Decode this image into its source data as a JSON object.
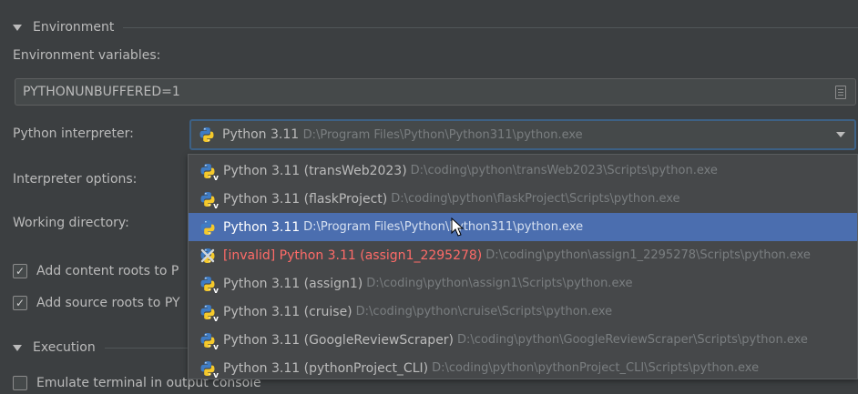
{
  "environment": {
    "section_title": "Environment",
    "env_vars_label": "Environment variables:",
    "env_vars_value": "PYTHONUNBUFFERED=1",
    "interpreter_label": "Python interpreter:",
    "interpreter_selected_name": "Python 3.11",
    "interpreter_selected_path": "D:\\Program Files\\Python\\Python311\\python.exe",
    "interpreter_options_label": "Interpreter options:",
    "working_dir_label": "Working directory:",
    "content_roots_label": "Add content roots to P",
    "source_roots_label": "Add source roots to PY"
  },
  "execution": {
    "section_title": "Execution",
    "emulate_terminal_label": "Emulate terminal in output console"
  },
  "dropdown": {
    "options": [
      {
        "name": "Python 3.11 (transWeb2023)",
        "path": "D:\\coding\\python\\transWeb2023\\Scripts\\python.exe"
      },
      {
        "name": "Python 3.11 (flaskProject)",
        "path": "D:\\coding\\python\\flaskProject\\Scripts\\python.exe"
      },
      {
        "name": "Python 3.11",
        "path": "D:\\Program Files\\Python\\Python311\\python.exe"
      },
      {
        "name": "[invalid] Python 3.11 (assign1_2295278)",
        "path": "D:\\coding\\python\\assign1_2295278\\Scripts\\python.exe"
      },
      {
        "name": "Python 3.11 (assign1)",
        "path": "D:\\coding\\python\\assign1\\Scripts\\python.exe"
      },
      {
        "name": "Python 3.11 (cruise)",
        "path": "D:\\coding\\python\\cruise\\Scripts\\python.exe"
      },
      {
        "name": "Python 3.11 (GoogleReviewScraper)",
        "path": "D:\\coding\\python\\GoogleReviewScraper\\Scripts\\python.exe"
      },
      {
        "name": "Python 3.11 (pythonProject_CLI)",
        "path": "D:\\coding\\python\\pythonProject_CLI\\Scripts\\python.exe"
      }
    ],
    "selected_index": 2,
    "invalid_index": 3
  },
  "colors": {
    "background": "#3c3f41",
    "selection": "#4b6eaf",
    "invalid": "#ff6b68",
    "focus_border": "#3d6185"
  },
  "icons": {
    "python": "python-icon",
    "venv": "python-venv-icon",
    "invalid": "python-invalid-icon",
    "dropdown": "chevron-down-icon",
    "edit_env": "document-icon"
  }
}
